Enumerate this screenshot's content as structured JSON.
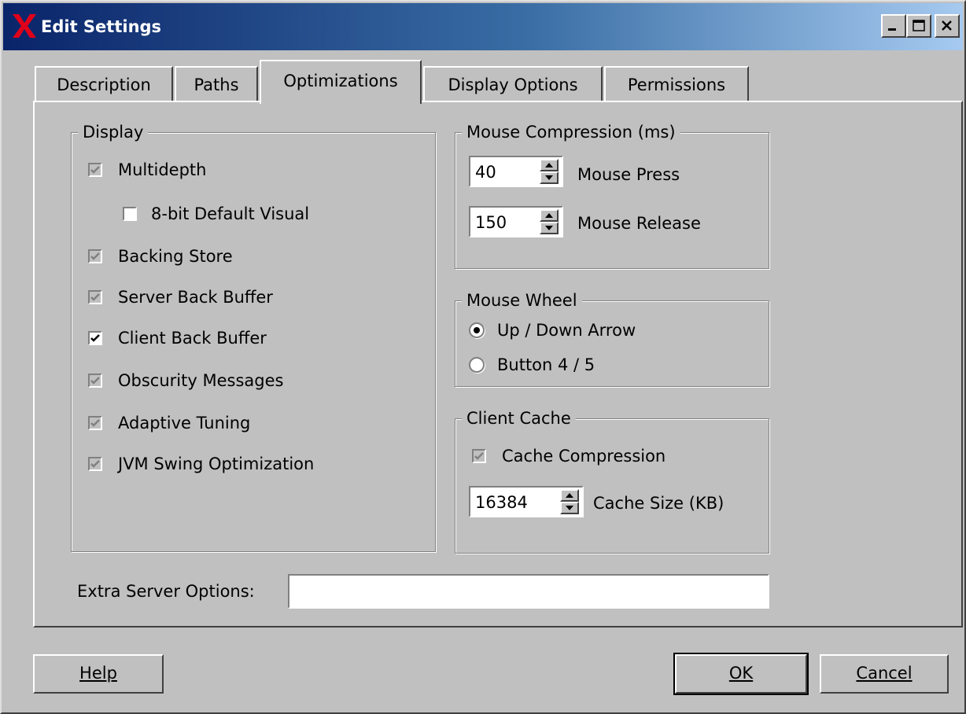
{
  "window": {
    "title": "Edit Settings",
    "controls": [
      "minimize-icon",
      "maximize-icon",
      "close-icon"
    ]
  },
  "tabs": [
    {
      "label": "Description",
      "selected": false
    },
    {
      "label": "Paths",
      "selected": false
    },
    {
      "label": "Optimizations",
      "selected": true
    },
    {
      "label": "Display Options",
      "selected": false
    },
    {
      "label": "Permissions",
      "selected": false
    }
  ],
  "display_group": {
    "title": "Display",
    "items": [
      {
        "label": "Multidepth",
        "checked": true,
        "enabled": false
      },
      {
        "label": "8-bit Default Visual",
        "checked": false,
        "enabled": true
      },
      {
        "label": "Backing Store",
        "checked": true,
        "enabled": false
      },
      {
        "label": "Server Back Buffer",
        "checked": true,
        "enabled": false
      },
      {
        "label": "Client Back Buffer",
        "checked": true,
        "enabled": true
      },
      {
        "label": "Obscurity Messages",
        "checked": true,
        "enabled": false
      },
      {
        "label": "Adaptive Tuning",
        "checked": true,
        "enabled": false
      },
      {
        "label": "JVM Swing Optimization",
        "checked": true,
        "enabled": false
      }
    ]
  },
  "mouse_compression": {
    "title": "Mouse Compression (ms)",
    "press": {
      "value": "40",
      "label": "Mouse Press"
    },
    "release": {
      "value": "150",
      "label": "Mouse Release"
    }
  },
  "mouse_wheel": {
    "title": "Mouse Wheel",
    "options": [
      {
        "label": "Up / Down Arrow",
        "selected": true
      },
      {
        "label": "Button 4 / 5",
        "selected": false
      }
    ]
  },
  "client_cache": {
    "title": "Client Cache",
    "compression": {
      "label": "Cache Compression",
      "checked": true,
      "enabled": false
    },
    "size": {
      "value": "16384",
      "label": "Cache Size (KB)"
    }
  },
  "extra_server_options": {
    "label": "Extra Server Options:",
    "value": ""
  },
  "buttons": {
    "help": "Help",
    "ok": "OK",
    "cancel": "Cancel"
  },
  "colors": {
    "face": "#c0c0c0",
    "title_start": "#0a246a",
    "title_end": "#a6caf0",
    "logo_red": "#e0001a"
  }
}
